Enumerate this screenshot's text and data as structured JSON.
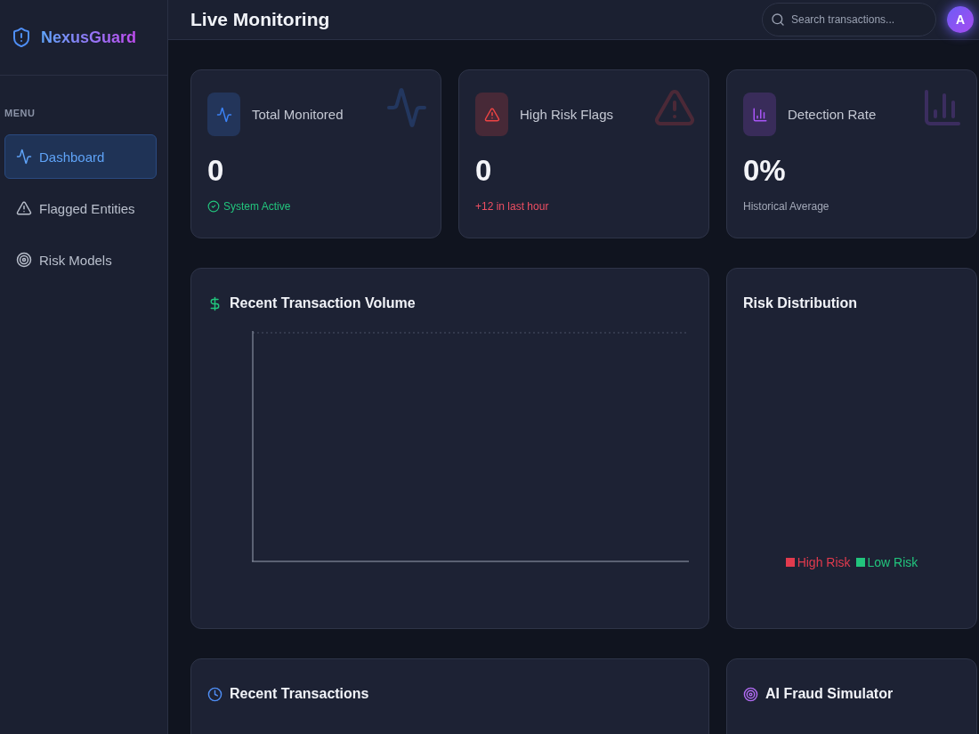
{
  "brand": {
    "name": "NexusGuard"
  },
  "sidebar": {
    "section_label": "MENU",
    "items": [
      {
        "label": "Dashboard",
        "kind": "pulse",
        "selected": true
      },
      {
        "label": "Flagged Entities",
        "kind": "alert",
        "selected": false
      },
      {
        "label": "Risk Models",
        "kind": "target",
        "selected": false
      }
    ]
  },
  "header": {
    "title": "Live Monitoring",
    "search": {
      "placeholder": "Search transactions..."
    },
    "avatar": "A"
  },
  "stats": [
    {
      "kind": "pulse",
      "label": "Total Monitored",
      "value": "0",
      "note": "System Active",
      "color": "#3b82f6"
    },
    {
      "kind": "alert",
      "label": "High Risk Flags",
      "value": "0",
      "note": "+12 in last hour",
      "color": "#ef4444"
    },
    {
      "kind": "bars",
      "label": "Detection Rate",
      "value": "0%",
      "note": "Historical Average",
      "color": "#a855f7"
    }
  ],
  "volume_panel": {
    "title": "Recent Transaction Volume"
  },
  "risk_panel": {
    "title": "Risk Distribution",
    "legend": [
      {
        "label": "High Risk",
        "color": "#e23b4e"
      },
      {
        "label": "Low Risk",
        "color": "#22c57d"
      }
    ]
  },
  "transactions_panel": {
    "title": "Recent Transactions"
  },
  "simulator_panel": {
    "title": "AI Fraud Simulator"
  }
}
